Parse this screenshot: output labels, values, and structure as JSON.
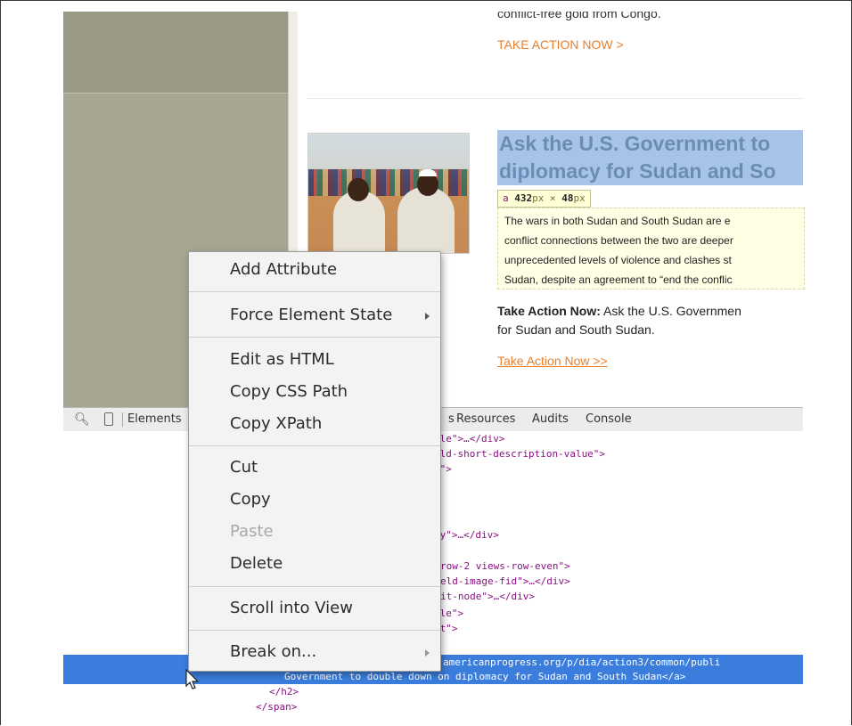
{
  "page": {
    "top_text": "conflict-free gold from Congo.",
    "take_action_top": "TAKE ACTION NOW >",
    "headline_line1": "Ask the U.S. Government to",
    "headline_line2": "diplomacy for Sudan and So",
    "tooltip": {
      "tag": "a",
      "width": "432",
      "height": "48",
      "unit": "px",
      "times": "×"
    },
    "summary_lines": [
      "The wars in both Sudan and South Sudan are e",
      "conflict connections between the two are deeper",
      "unprecedented levels of violence and clashes st",
      "Sudan, despite an agreement to “end the conflic"
    ],
    "action_bold": "Take Action Now:",
    "action_text": " Ask the U.S. Governmen",
    "action_line2": "for Sudan and South Sudan.",
    "take_action_link": "Take Action Now >>"
  },
  "devtools": {
    "tabs": [
      "Elements",
      "s",
      "Resources",
      "Audits",
      "Console"
    ],
    "code_lines": [
      {
        "text": "tle\">…</div>"
      },
      {
        "text": "eld-short-description-value\">"
      },
      {
        "text": "t\">"
      },
      {
        "text": "dy\">…</div>"
      },
      {
        "text": "row-2 views-row-even\">"
      },
      {
        "text": "eld-image-fid\">…</div>"
      },
      {
        "text": "it-node\">…</div>"
      },
      {
        "text": "tle\">"
      },
      {
        "text": "nt\">"
      }
    ],
    "selected_line1": "americanprogress.org/p/dia/action3/common/publi",
    "selected_line2": "Government to double down on diplomacy for Sudan and South Sudan</a>",
    "closing_h2": "</h2>",
    "closing_span": "</span>"
  },
  "context_menu": {
    "items": [
      {
        "label": "Add Attribute"
      },
      {
        "label": "Force Element State"
      },
      {
        "label": "Edit as HTML"
      },
      {
        "label": "Copy CSS Path"
      },
      {
        "label": "Copy XPath"
      },
      {
        "label": "Cut"
      },
      {
        "label": "Copy"
      },
      {
        "label": "Paste"
      },
      {
        "label": "Delete"
      },
      {
        "label": "Scroll into View"
      },
      {
        "label": "Break on..."
      }
    ]
  }
}
